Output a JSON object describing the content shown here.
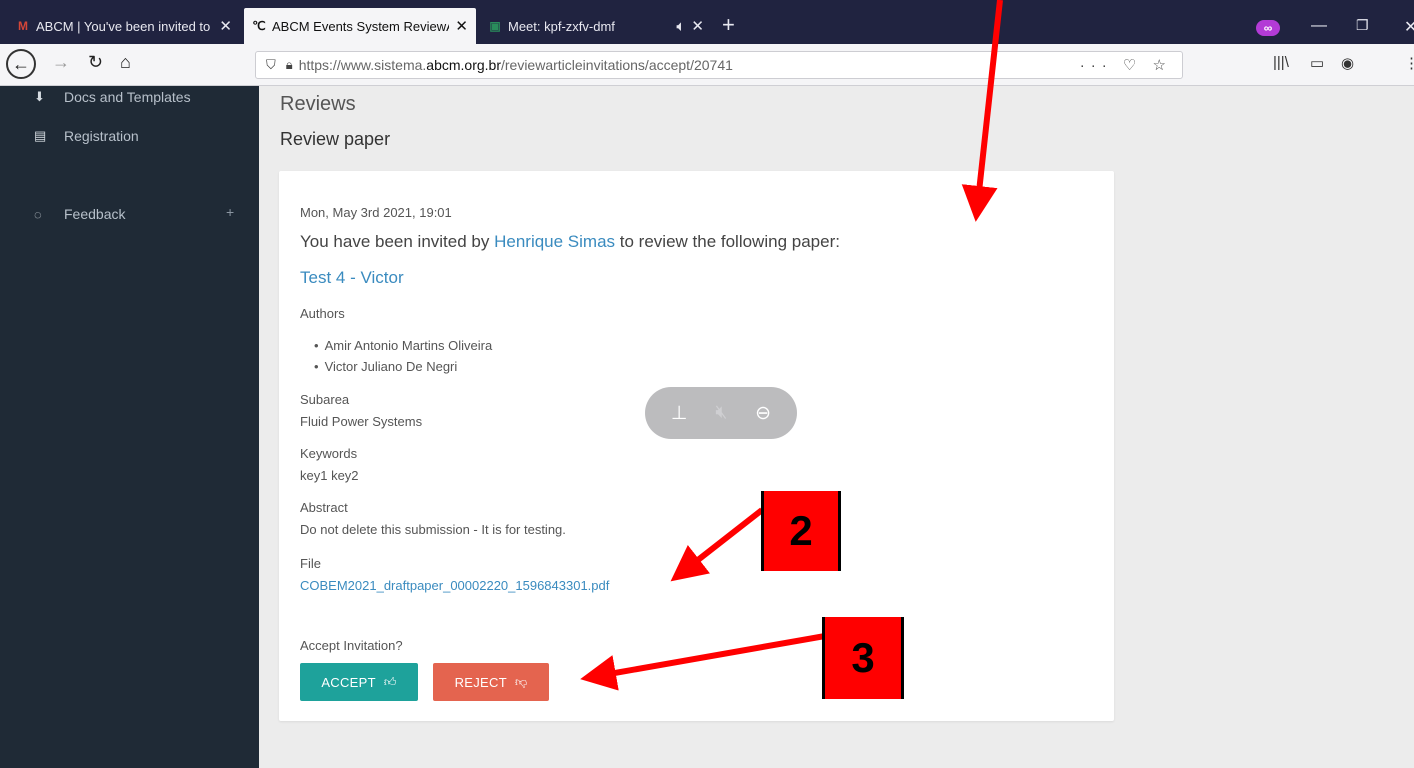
{
  "browser": {
    "tabs": [
      {
        "label": "ABCM | You've been invited to",
        "icon": "gmail-icon",
        "glyph": "M",
        "glyph_color": "#d44638"
      },
      {
        "label": "ABCM Events System ReviewAr",
        "icon": "abcm-logo-icon",
        "glyph": "℃",
        "glyph_color": "#333333"
      },
      {
        "label": "Meet: kpf-zxfv-dmf",
        "icon": "meet-icon",
        "glyph": "▣",
        "glyph_color": "#2a8d5c"
      }
    ],
    "close_glyph": "✕",
    "new_tab_glyph": "+",
    "url_scheme": "https://www.sistema.",
    "url_host": "abcm.org.br",
    "url_path": "/reviewarticleinvitations/accept/20741"
  },
  "sidebar": {
    "items": [
      {
        "label": "Docs and Templates",
        "icon": "download-icon"
      },
      {
        "label": "Registration",
        "icon": "document-icon"
      },
      {
        "label": "Feedback",
        "icon": "chat-icon"
      }
    ],
    "plus": "+"
  },
  "page": {
    "title": "Reviews",
    "subtitle": "Review paper"
  },
  "invitation": {
    "date": "Mon, May 3rd 2021, 19:01",
    "invited_prefix": "You have been invited by ",
    "inviter": "Henrique Simas",
    "invited_suffix": " to review the following paper:",
    "paper_title": "Test 4 - Victor",
    "authors_label": "Authors",
    "authors": [
      "Amir Antonio Martins Oliveira",
      "Victor Juliano De Negri"
    ],
    "subarea_label": "Subarea",
    "subarea": "Fluid Power Systems",
    "keywords_label": "Keywords",
    "keywords": "key1 key2",
    "abstract_label": "Abstract",
    "abstract": "Do not delete this submission - It is for testing.",
    "file_label": "File",
    "file_name": "COBEM2021_draftpaper_00002220_1596843301.pdf",
    "accept_question": "Accept Invitation?",
    "accept_label": "ACCEPT",
    "reject_label": "REJECT"
  },
  "annotations": {
    "box2": "2",
    "box3": "3",
    "arrow_color": "#ff0000"
  }
}
